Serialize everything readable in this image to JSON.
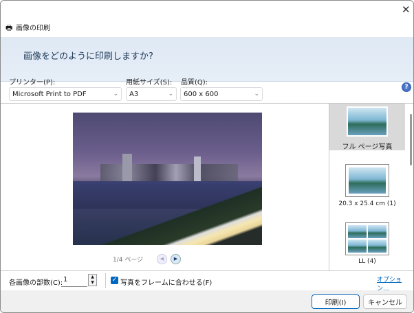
{
  "window": {
    "title": "画像の印刷",
    "close_icon": "close-icon",
    "printer_icon": "printer-icon"
  },
  "header": {
    "question": "画像をどのように印刷しますか?"
  },
  "controls": {
    "printer": {
      "label": "プリンター(P):",
      "value": "Microsoft Print to PDF"
    },
    "paper": {
      "label": "用紙サイズ(S):",
      "value": "A3"
    },
    "quality": {
      "label": "品質(Q):",
      "value": "600 x 600"
    },
    "help_icon": "help-icon"
  },
  "preview": {
    "page_label": "1/4 ページ"
  },
  "layouts": [
    {
      "label": "フル ページ写真",
      "selected": true
    },
    {
      "label": "20.3 x 25.4 cm (1)"
    },
    {
      "label": "LL (4)"
    }
  ],
  "options": {
    "copies_label": "各画像の部数(C):",
    "copies_value": "1",
    "fit_label": "写真をフレームに合わせる(F)",
    "fit_checked": true,
    "options_link": "オプション..."
  },
  "footer": {
    "print": "印刷(I)",
    "cancel": "キャンセル"
  },
  "colors": {
    "header_bg": "#dfe9f4",
    "accent": "#0067c0"
  }
}
